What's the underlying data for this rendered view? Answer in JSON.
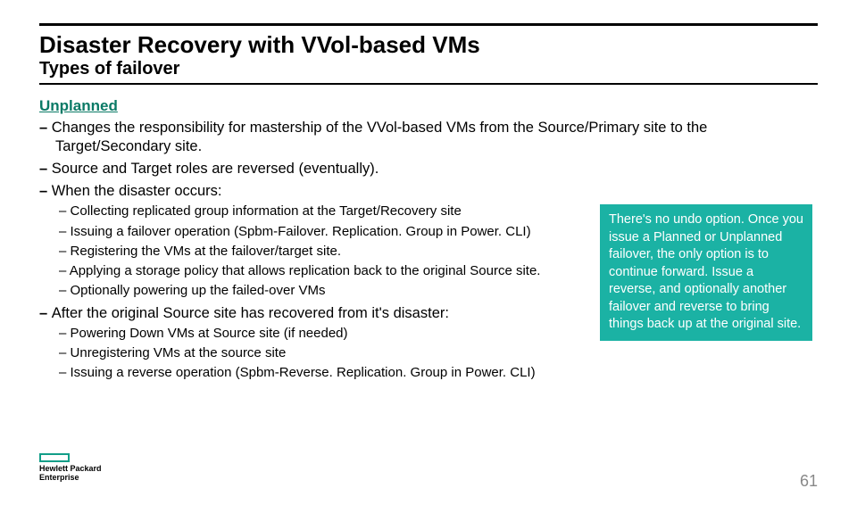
{
  "title": "Disaster Recovery with VVol-based VMs",
  "subtitle": "Types of failover",
  "section_head": "Unplanned",
  "lvl1": {
    "a": "Changes the responsibility for mastership of the VVol-based VMs from the Source/Primary site to the Target/Secondary site.",
    "b": "Source and Target roles are reversed (eventually).",
    "c": "When the disaster occurs:",
    "d": "After the original Source site has recovered from it's disaster:"
  },
  "lvl2_disaster": {
    "a": "Collecting replicated group information at the Target/Recovery site",
    "b": "Issuing a failover operation (Spbm-Failover. Replication. Group in Power. CLI)",
    "c": "Registering the VMs at the failover/target site.",
    "d": "Applying a storage policy that allows replication back to the original Source site.",
    "e": "Optionally powering up the failed-over VMs"
  },
  "lvl2_recover": {
    "a": "Powering Down VMs at Source site (if needed)",
    "b": "Unregistering VMs at the source site",
    "c": "Issuing a reverse operation (Spbm-Reverse. Replication. Group in Power. CLI)"
  },
  "callout": "There's no undo option. Once you issue a Planned or Unplanned failover, the only option is to continue forward. Issue a reverse, and optionally another failover and reverse to bring things back up at the original site.",
  "logo_line1": "Hewlett Packard",
  "logo_line2": "Enterprise",
  "page_number": "61"
}
